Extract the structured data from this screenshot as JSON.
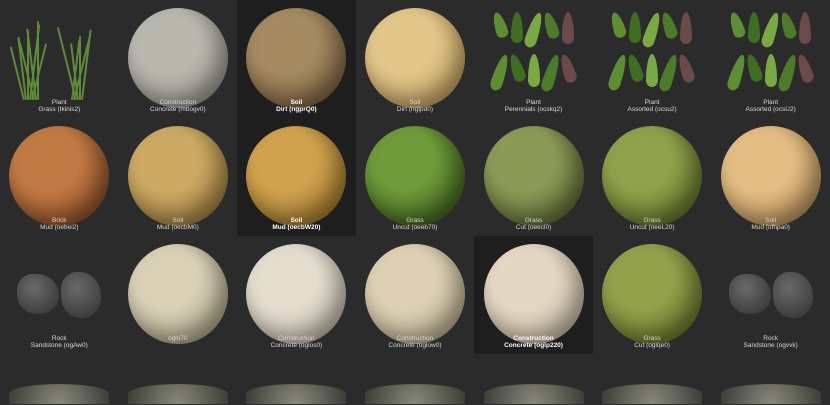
{
  "assets": [
    {
      "category": "Plant",
      "name": "Grass (tkinis2)",
      "kind": "grass"
    },
    {
      "category": "Construction",
      "name": "Concrete (mbogv0)",
      "kind": "sphere",
      "colors": [
        "#b9b8ae",
        "#8e8b82"
      ]
    },
    {
      "category": "Soil",
      "name": "Dirt (ngprQ0)",
      "kind": "sphere",
      "colors": [
        "#a58a62",
        "#6f5633"
      ],
      "selected": true
    },
    {
      "category": "Soil",
      "name": "Dirt (ngtpd0)",
      "kind": "sphere",
      "colors": [
        "#e2c68a",
        "#b6924f"
      ]
    },
    {
      "category": "Plant",
      "name": "Perennials (ocskq2)",
      "kind": "leaves"
    },
    {
      "category": "Plant",
      "name": "Assorted (ocsu2)",
      "kind": "leaves"
    },
    {
      "category": "Plant",
      "name": "Assorted (ocsU2)",
      "kind": "leaves"
    },
    {
      "category": "Brick",
      "name": "Mud (oebei2)",
      "kind": "sphere",
      "colors": [
        "#c17a44",
        "#7a3e1d"
      ]
    },
    {
      "category": "Soil",
      "name": "Mud (oecbM0)",
      "kind": "sphere",
      "colors": [
        "#cdaa63",
        "#8c6e34"
      ]
    },
    {
      "category": "Soil",
      "name": "Mud (oecbW20)",
      "kind": "sphere",
      "colors": [
        "#d0a24e",
        "#8d6723"
      ],
      "selected": true
    },
    {
      "category": "Grass",
      "name": "Uncut (oeeb70)",
      "kind": "sphere",
      "colors": [
        "#6f9a39",
        "#2b4b15"
      ]
    },
    {
      "category": "Grass",
      "name": "Cut (oeecl0)",
      "kind": "sphere",
      "colors": [
        "#8c9a57",
        "#4a5a25"
      ]
    },
    {
      "category": "Grass",
      "name": "Uncut (oeeL20)",
      "kind": "sphere",
      "colors": [
        "#8fa14a",
        "#4e6220"
      ]
    },
    {
      "category": "Soil",
      "name": "Mud (ofhpa0)",
      "kind": "sphere",
      "colors": [
        "#e3bd84",
        "#a9804a"
      ]
    },
    {
      "category": "Rock",
      "name": "Sandstone (ogAw0)",
      "kind": "rocks"
    },
    {
      "category": "",
      "name": "oglo70",
      "kind": "sphere",
      "colors": [
        "#d9d0b6",
        "#9b9276"
      ]
    },
    {
      "category": "Construction",
      "name": "Concrete (oglos0)",
      "kind": "sphere",
      "colors": [
        "#e4ddce",
        "#b3aa98"
      ]
    },
    {
      "category": "Construction",
      "name": "Concrete (oglow0)",
      "kind": "sphere",
      "colors": [
        "#ddd0b4",
        "#ad9f80"
      ]
    },
    {
      "category": "Construction",
      "name": "Concrete (oglp220)",
      "kind": "sphere",
      "colors": [
        "#e4d8c4",
        "#b8a990"
      ],
      "selected": true
    },
    {
      "category": "Grass",
      "name": "Cut (oglqe0)",
      "kind": "sphere",
      "colors": [
        "#93a14b",
        "#55651f"
      ]
    },
    {
      "category": "Rock",
      "name": "Sandstone (ogvvk)",
      "kind": "rocks"
    }
  ]
}
